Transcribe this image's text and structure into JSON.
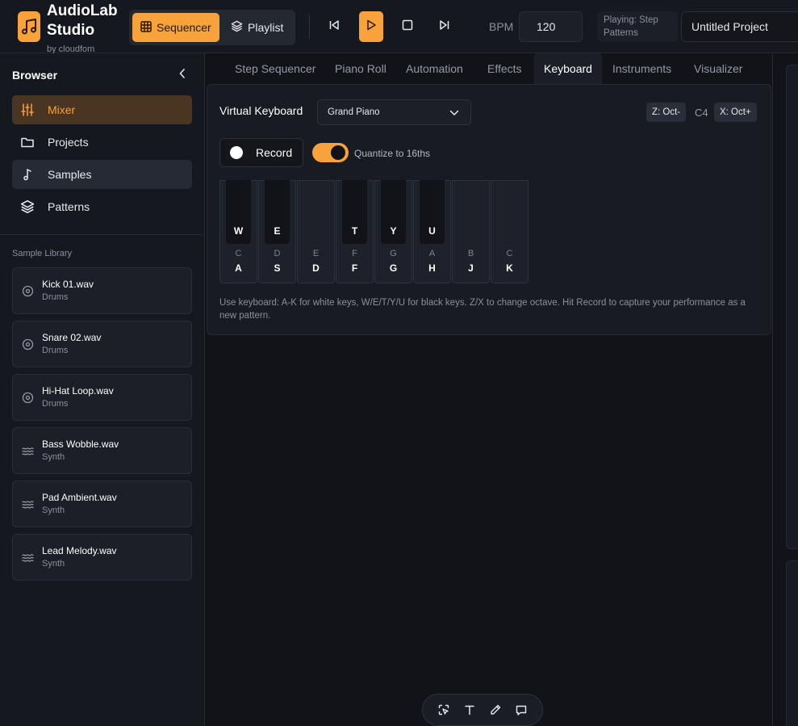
{
  "header": {
    "app_title": "AudioLab Studio",
    "app_subtitle": "by cloudfom",
    "modes": [
      {
        "label": "Sequencer",
        "icon": "grid-icon",
        "active": true
      },
      {
        "label": "Playlist",
        "icon": "layers-icon",
        "active": false
      }
    ],
    "transport": [
      "skip-back-icon",
      "play-icon",
      "stop-icon",
      "skip-forward-icon"
    ],
    "bpm_label": "BPM",
    "bpm_value": "120",
    "playing_text": "Playing: Step Patterns",
    "project_name": "Untitled Project"
  },
  "sidebar": {
    "title": "Browser",
    "nav": [
      {
        "label": "Mixer",
        "icon": "sliders-icon"
      },
      {
        "label": "Projects",
        "icon": "folder-icon"
      },
      {
        "label": "Samples",
        "icon": "music-note-icon"
      },
      {
        "label": "Patterns",
        "icon": "layers-icon"
      }
    ],
    "library_title": "Sample Library",
    "samples": [
      {
        "name": "Kick 01.wav",
        "category": "Drums",
        "icon": "disc-icon"
      },
      {
        "name": "Snare 02.wav",
        "category": "Drums",
        "icon": "disc-icon"
      },
      {
        "name": "Hi-Hat Loop.wav",
        "category": "Drums",
        "icon": "disc-icon"
      },
      {
        "name": "Bass Wobble.wav",
        "category": "Synth",
        "icon": "wave-icon"
      },
      {
        "name": "Pad Ambient.wav",
        "category": "Synth",
        "icon": "wave-icon"
      },
      {
        "name": "Lead Melody.wav",
        "category": "Synth",
        "icon": "wave-icon"
      }
    ]
  },
  "tabs": [
    "Step Sequencer",
    "Piano Roll",
    "Automation",
    "Effects",
    "Keyboard",
    "Instruments",
    "Visualizer"
  ],
  "active_tab": "Keyboard",
  "keyboard": {
    "title": "Virtual Keyboard",
    "instrument": "Grand Piano",
    "oct_down": "Z: Oct-",
    "octave": "C4",
    "oct_up": "X: Oct+",
    "record_label": "Record",
    "quantize_label": "Quantize to 16ths",
    "quantize_on": true,
    "white_keys": [
      {
        "note": "C",
        "key": "A"
      },
      {
        "note": "D",
        "key": "S"
      },
      {
        "note": "E",
        "key": "D"
      },
      {
        "note": "F",
        "key": "F"
      },
      {
        "note": "G",
        "key": "G"
      },
      {
        "note": "A",
        "key": "H"
      },
      {
        "note": "B",
        "key": "J"
      },
      {
        "note": "C",
        "key": "K"
      }
    ],
    "black_keys": [
      "W",
      "E",
      "T",
      "Y",
      "U"
    ],
    "help": "Use keyboard: A-K for white keys, W/E/T/Y/U for black keys. Z/X to change octave. Hit Record to capture your performance as a new pattern."
  },
  "float_toolbar": [
    "select-icon",
    "text-icon",
    "pen-icon",
    "comment-icon"
  ],
  "colors": {
    "accent": "#f7a23a",
    "background": "#111319",
    "panel": "#181b22"
  }
}
